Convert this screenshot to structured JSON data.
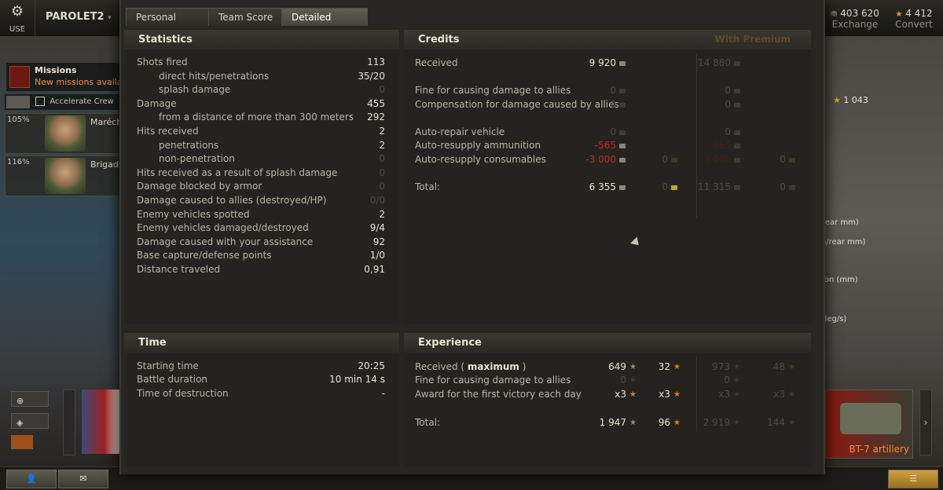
{
  "topbar": {
    "use_label": "USE",
    "player": "PAROLET2",
    "credits_value": "403 620",
    "credits_label": "Exchange",
    "gold_value": "4 412",
    "gold_label": "Convert"
  },
  "sidebar": {
    "missions_title": "Missions",
    "missions_sub": "New missions available",
    "accelerate": "Accelerate Crew",
    "crew": [
      {
        "pct": "105%",
        "rank": "Maréchal"
      },
      {
        "pct": "116%",
        "rank": "Brigadier"
      }
    ]
  },
  "right": {
    "gold": "1 043",
    "spec1": "rear mm)",
    "spec2": "s/rear mm)",
    "spec3": "ion (mm)",
    "spec4": ")",
    "spec5": "deg/s)",
    "tank_name": "BT-7 artillery"
  },
  "tabs": [
    "Personal Score",
    "Team Score",
    "Detailed Report"
  ],
  "statistics": {
    "title": "Statistics",
    "rows": [
      {
        "label": "Shots fired",
        "value": "113",
        "indent": false,
        "dim": false
      },
      {
        "label": "direct hits/penetrations",
        "value": "35/20",
        "indent": true,
        "dim": false
      },
      {
        "label": "splash damage",
        "value": "0",
        "indent": true,
        "dim": true
      },
      {
        "label": "Damage",
        "value": "455",
        "indent": false,
        "dim": false
      },
      {
        "label": "from a distance of more than 300 meters",
        "value": "292",
        "indent": true,
        "dim": false
      },
      {
        "label": "Hits received",
        "value": "2",
        "indent": false,
        "dim": false
      },
      {
        "label": "penetrations",
        "value": "2",
        "indent": true,
        "dim": false
      },
      {
        "label": "non-penetration",
        "value": "0",
        "indent": true,
        "dim": true
      },
      {
        "label": "Hits received as a result of splash damage",
        "value": "0",
        "indent": false,
        "dim": true
      },
      {
        "label": "Damage blocked by armor",
        "value": "0",
        "indent": false,
        "dim": true
      },
      {
        "label": "Damage caused to allies (destroyed/HP)",
        "value": "0/0",
        "indent": false,
        "dim": true
      },
      {
        "label": "Enemy vehicles spotted",
        "value": "2",
        "indent": false,
        "dim": false
      },
      {
        "label": "Enemy vehicles damaged/destroyed",
        "value": "9/4",
        "indent": false,
        "dim": false
      },
      {
        "label": "Damage caused with your assistance",
        "value": "92",
        "indent": false,
        "dim": false
      },
      {
        "label": "Base capture/defense points",
        "value": "1/0",
        "indent": false,
        "dim": false
      },
      {
        "label": "Distance traveled",
        "value": "0,91",
        "indent": false,
        "dim": false
      }
    ]
  },
  "credits": {
    "title": "Credits",
    "premium_label": "With Premium",
    "received": {
      "label": "Received",
      "value": "9 920",
      "premium": "14 880"
    },
    "fine": {
      "label": "Fine for causing damage to allies",
      "value": "0",
      "premium": "0"
    },
    "compensation": {
      "label": "Compensation for damage caused by allies",
      "value": "0",
      "premium": "0"
    },
    "autorepair": {
      "label": "Auto-repair vehicle",
      "value": "0",
      "premium": "0"
    },
    "ammo": {
      "label": "Auto-resupply ammunition",
      "value": "-565",
      "premium": "-565"
    },
    "consumables": {
      "label": "Auto-resupply consumables",
      "value": "-3 000",
      "gold": "0",
      "premium": "-3 000",
      "premium_gold": "0"
    },
    "total": {
      "label": "Total:",
      "value": "6 355",
      "gold": "0",
      "premium": "11 315",
      "premium_gold": "0"
    }
  },
  "time": {
    "title": "Time",
    "rows": [
      {
        "label": "Starting time",
        "value": "20:25"
      },
      {
        "label": "Battle duration",
        "value": "10 min 14 s"
      },
      {
        "label": "Time of destruction",
        "value": "-"
      }
    ]
  },
  "experience": {
    "title": "Experience",
    "received_label": "Received (",
    "received_bold": "maximum",
    "received_close": ")",
    "received": {
      "xp": "649",
      "free": "32",
      "p_xp": "973",
      "p_free": "48"
    },
    "fine": {
      "label": "Fine for causing damage to allies",
      "xp": "0",
      "p_xp": "0"
    },
    "award": {
      "label": "Award for the first victory each day",
      "xp": "x3",
      "free": "x3",
      "p_xp": "x3",
      "p_free": "x3"
    },
    "total": {
      "label": "Total:",
      "xp": "1 947",
      "free": "96",
      "p_xp": "2 919",
      "p_free": "144"
    }
  },
  "bottom": {
    "chat_icon": "chat-icon",
    "user_icon": "user-icon"
  }
}
